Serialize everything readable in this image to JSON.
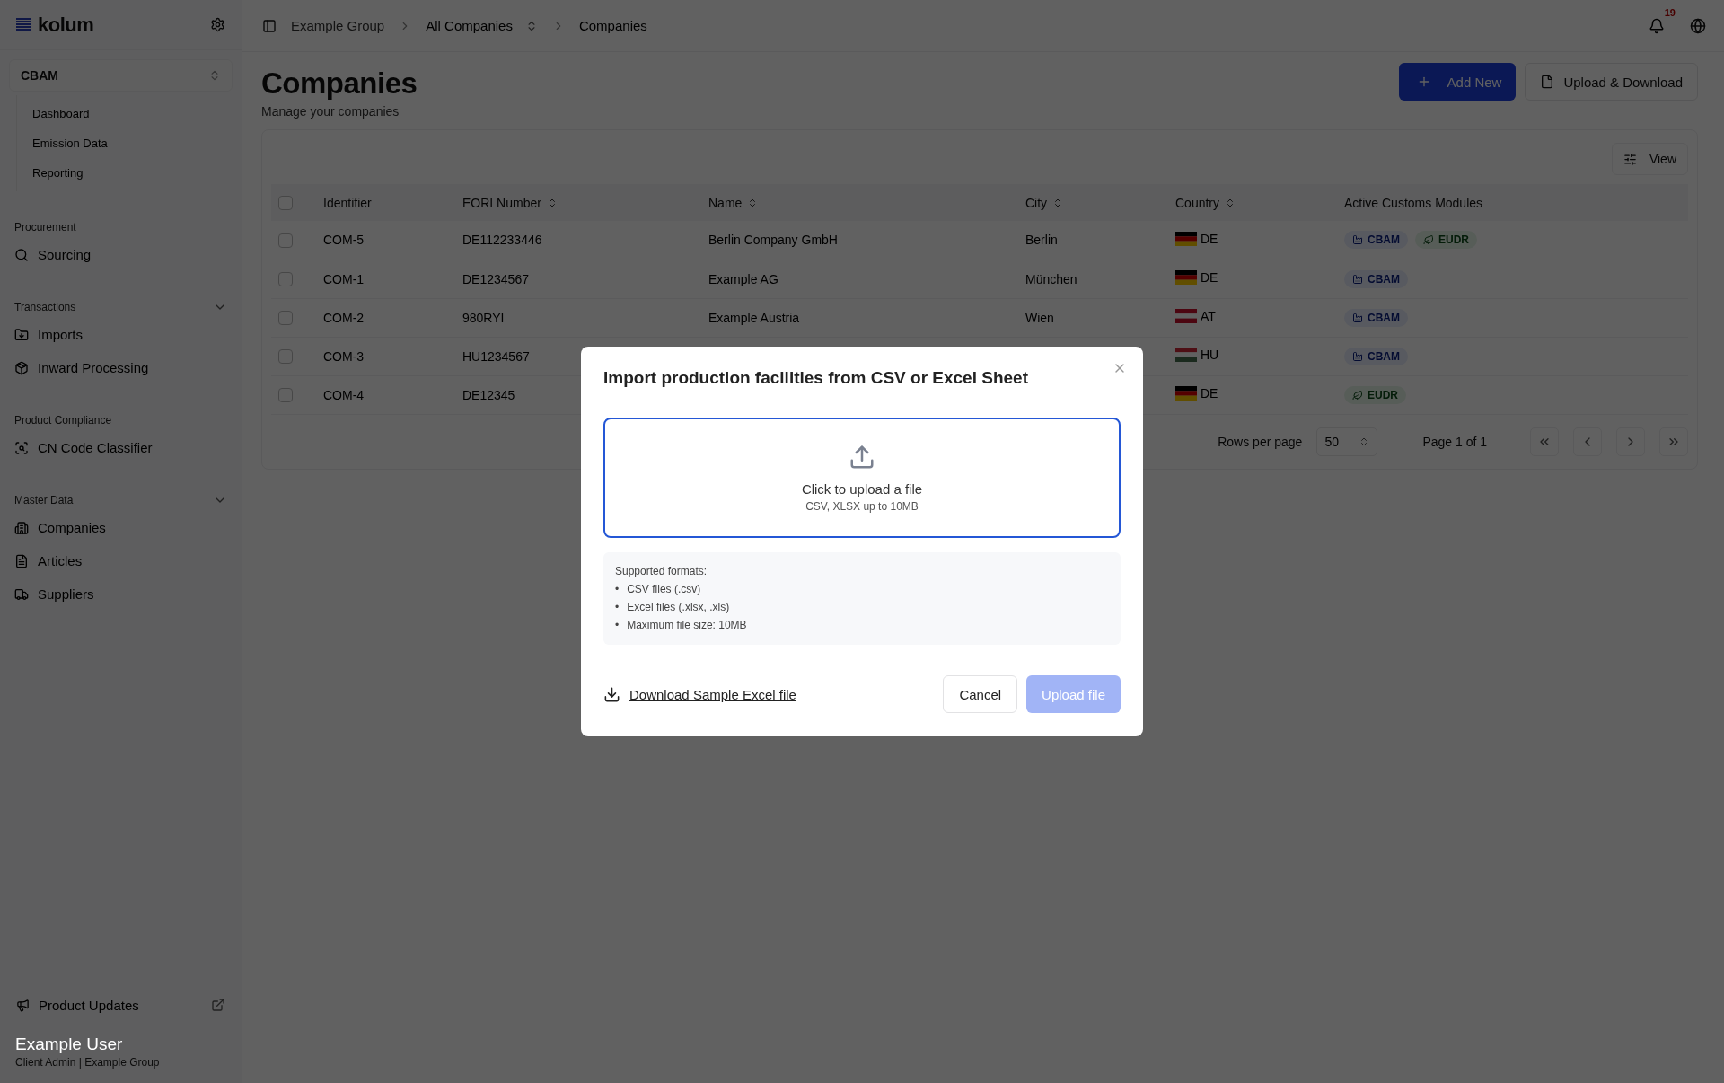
{
  "sidebar": {
    "logo": "kolum",
    "module_selector": "CBAM",
    "module_items": [
      {
        "label": "Dashboard"
      },
      {
        "label": "Emission Data"
      },
      {
        "label": "Reporting"
      }
    ],
    "sections": [
      {
        "title": "Procurement",
        "kind": "plain",
        "items": [
          {
            "label": "Sourcing"
          }
        ]
      },
      {
        "title": "Transactions",
        "kind": "collapsible",
        "items": [
          {
            "label": "Imports"
          },
          {
            "label": "Inward Processing"
          }
        ]
      },
      {
        "title": "Product Compliance",
        "kind": "plain",
        "items": [
          {
            "label": "CN Code Classifier"
          }
        ]
      },
      {
        "title": "Master Data",
        "kind": "collapsible",
        "items": [
          {
            "label": "Companies"
          },
          {
            "label": "Articles"
          },
          {
            "label": "Suppliers"
          }
        ]
      }
    ],
    "product_updates": "Product Updates",
    "user": {
      "name": "Example User",
      "role": "Client Admin | Example Group"
    }
  },
  "header": {
    "breadcrumbs": [
      {
        "label": "Example Group",
        "kind": "link"
      },
      {
        "label": "All Companies",
        "kind": "switcher"
      },
      {
        "label": "Companies",
        "kind": "current"
      }
    ],
    "notification_count": "19"
  },
  "page": {
    "title": "Companies",
    "subtitle": "Manage your companies",
    "add_button": "Add New",
    "upload_button": "Upload & Download",
    "view_button": "View"
  },
  "table": {
    "columns": [
      {
        "label": "Identifier",
        "sortable": false
      },
      {
        "label": "EORI Number",
        "sortable": true
      },
      {
        "label": "Name",
        "sortable": true
      },
      {
        "label": "City",
        "sortable": true
      },
      {
        "label": "Country",
        "sortable": true
      },
      {
        "label": "Active Customs Modules",
        "sortable": false
      }
    ],
    "all_selected": false,
    "rows": [
      {
        "selected": false,
        "identifier": "COM-5",
        "eori": "DE112233446",
        "name": "Berlin Company GmbH",
        "city": "Berlin",
        "country": {
          "code": "DE",
          "kind": "de"
        },
        "modules": [
          {
            "label": "CBAM",
            "kind": "cbam"
          },
          {
            "label": "EUDR",
            "kind": "eudr"
          }
        ]
      },
      {
        "selected": false,
        "identifier": "COM-1",
        "eori": "DE1234567",
        "name": "Example AG",
        "city": "München",
        "country": {
          "code": "DE",
          "kind": "de"
        },
        "modules": [
          {
            "label": "CBAM",
            "kind": "cbam"
          }
        ]
      },
      {
        "selected": false,
        "identifier": "COM-2",
        "eori": "980RYI",
        "name": "Example Austria",
        "city": "Wien",
        "country": {
          "code": "AT",
          "kind": "at"
        },
        "modules": [
          {
            "label": "CBAM",
            "kind": "cbam"
          }
        ]
      },
      {
        "selected": false,
        "identifier": "COM-3",
        "eori": "HU1234567",
        "country": {
          "code": "HU",
          "kind": "hu"
        },
        "modules": [
          {
            "label": "CBAM",
            "kind": "cbam"
          }
        ]
      },
      {
        "selected": false,
        "identifier": "COM-4",
        "eori": "DE12345",
        "country": {
          "code": "DE",
          "kind": "de"
        },
        "modules": [
          {
            "label": "EUDR",
            "kind": "eudr"
          }
        ]
      }
    ]
  },
  "pagination": {
    "rows_per_page_label": "Rows per page",
    "rows_per_page": "50",
    "page_info": "Page 1 of 1"
  },
  "modal": {
    "title": "Import production facilities from CSV or Excel Sheet",
    "dropzone": {
      "title": "Click to upload a file",
      "hint": "CSV, XLSX up to 10MB"
    },
    "formats": {
      "heading": "Supported formats:",
      "bullet": "•",
      "items": [
        "CSV files (.csv)",
        "Excel files (.xlsx, .xls)",
        "Maximum file size: 10MB"
      ]
    },
    "download_link": "Download Sample Excel file",
    "cancel_button": "Cancel",
    "upload_button": {
      "label": "Upload file",
      "disabled": true
    }
  }
}
